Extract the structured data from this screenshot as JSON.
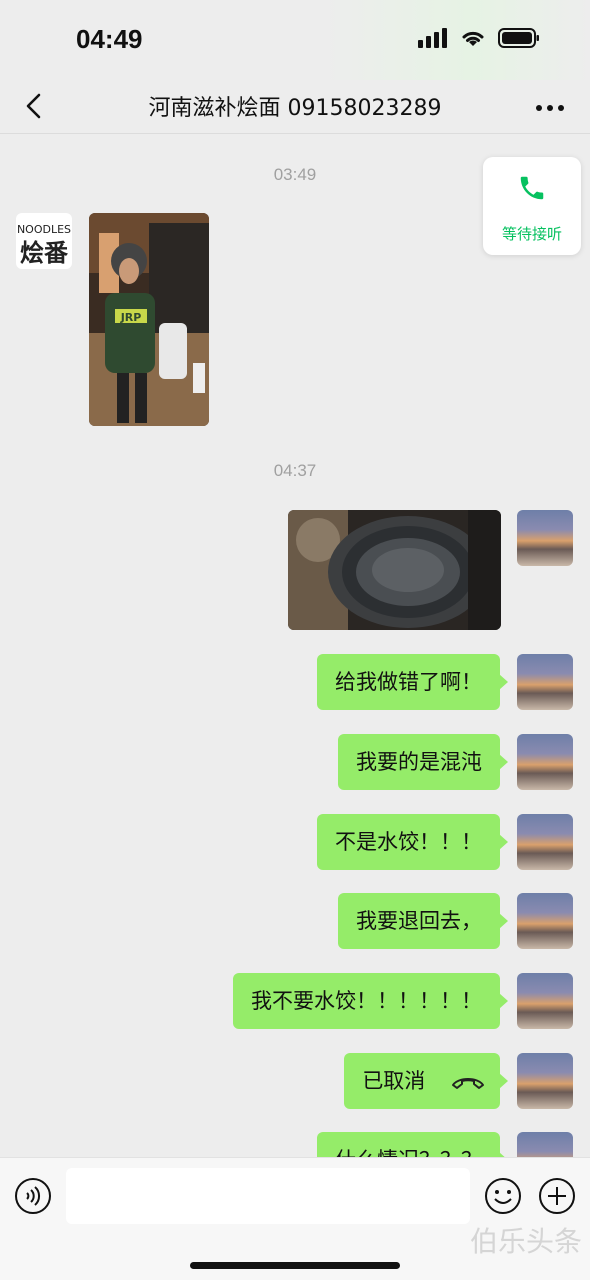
{
  "status": {
    "time": "04:49"
  },
  "nav": {
    "title": "河南滋补烩面 09158023289"
  },
  "colors": {
    "bubble": "#95ec69",
    "accent": "#07c160",
    "background": "#ededed"
  },
  "call_float": {
    "label": "等待接听",
    "icon": "phone-icon"
  },
  "shop_avatar": {
    "line1": "NOODLES",
    "line2": "烩番"
  },
  "messages": {
    "ts1": "03:49",
    "ts2": "04:37",
    "m1": "给我做错了啊！",
    "m2": "我要的是混沌",
    "m3": "不是水饺！！！",
    "m4": "我要退回去，",
    "m5": "我不要水饺！！！！！！",
    "m6": "已取消",
    "m7": "什么情况？？？"
  },
  "photos": {
    "incoming": {
      "shirt_text": "JRP"
    }
  },
  "input_bar": {
    "placeholder": ""
  },
  "watermark": "伯乐头条"
}
